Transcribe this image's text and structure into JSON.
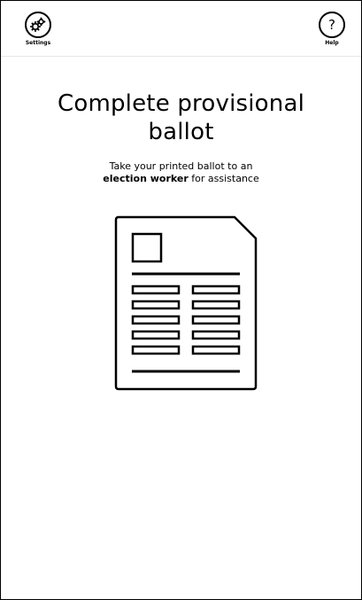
{
  "header": {
    "settings_label": "Settings",
    "help_label": "Help",
    "help_glyph": "?",
    "settings_icon": "gear-icon",
    "help_icon": "question-mark-icon"
  },
  "main": {
    "title_line1": "Complete provisional",
    "title_line2": "ballot",
    "subtitle_line1": "Take your printed ballot to an",
    "subtitle_bold": "election worker",
    "subtitle_rest": " for assistance",
    "illustration_icon": "ballot-document-icon"
  }
}
